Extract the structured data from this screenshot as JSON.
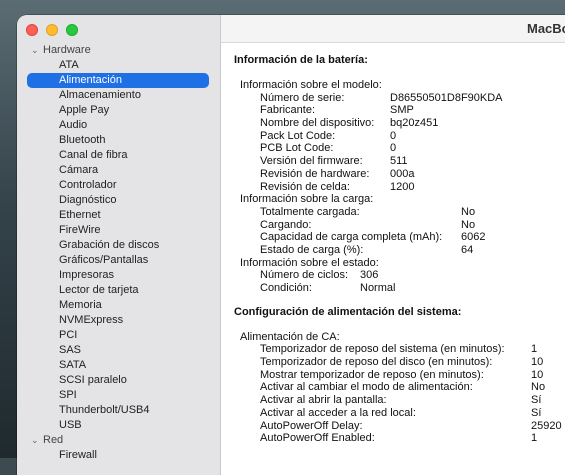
{
  "window": {
    "title": "MacBo"
  },
  "sidebar": {
    "groups": [
      {
        "label": "Hardware",
        "items": [
          "ATA",
          "Alimentación",
          "Almacenamiento",
          "Apple Pay",
          "Audio",
          "Bluetooth",
          "Canal de fibra",
          "Cámara",
          "Controlador",
          "Diagnóstico",
          "Ethernet",
          "FireWire",
          "Grabación de discos",
          "Gráficos/Pantallas",
          "Impresoras",
          "Lector de tarjeta",
          "Memoria",
          "NVMExpress",
          "PCI",
          "SAS",
          "SATA",
          "SCSI paralelo",
          "SPI",
          "Thunderbolt/USB4",
          "USB"
        ]
      },
      {
        "label": "Red",
        "items": [
          "Firewall"
        ]
      }
    ],
    "selected": "Alimentación"
  },
  "battery": {
    "heading": "Información de la batería:",
    "model": {
      "label": "Información sobre el modelo:",
      "rows": [
        {
          "k": "Número de serie:",
          "v": "D86550501D8F90KDA"
        },
        {
          "k": "Fabricante:",
          "v": "SMP"
        },
        {
          "k": "Nombre del dispositivo:",
          "v": "bq20z451"
        },
        {
          "k": "Pack Lot Code:",
          "v": "0"
        },
        {
          "k": "PCB Lot Code:",
          "v": "0"
        },
        {
          "k": "Versión del firmware:",
          "v": "511"
        },
        {
          "k": "Revisión de hardware:",
          "v": "000a"
        },
        {
          "k": "Revisión de celda:",
          "v": "1200"
        }
      ]
    },
    "charge": {
      "label": "Información sobre la carga:",
      "rows": [
        {
          "k": "Totalmente cargada:",
          "v": "No"
        },
        {
          "k": "Cargando:",
          "v": "No"
        },
        {
          "k": "Capacidad de carga completa (mAh):",
          "v": "6062"
        },
        {
          "k": "Estado de carga (%):",
          "v": "64"
        }
      ]
    },
    "status": {
      "label": "Información sobre el estado:",
      "rows": [
        {
          "k": "Número de ciclos:",
          "v": "306"
        },
        {
          "k": "Condición:",
          "v": "Normal"
        }
      ]
    }
  },
  "power": {
    "heading": "Configuración de alimentación del sistema:",
    "ac": {
      "label": "Alimentación de CA:",
      "rows": [
        {
          "k": "Temporizador de reposo del sistema (en minutos):",
          "v": "1"
        },
        {
          "k": "Temporizador de reposo del disco (en minutos):",
          "v": "10"
        },
        {
          "k": "Mostrar temporizador de reposo (en minutos):",
          "v": "10"
        },
        {
          "k": "Activar al cambiar el modo de alimentación:",
          "v": "No"
        },
        {
          "k": "Activar al abrir la pantalla:",
          "v": "Sí"
        },
        {
          "k": "Activar al acceder a la red local:",
          "v": "Sí"
        },
        {
          "k": "AutoPowerOff Delay:",
          "v": "25920"
        },
        {
          "k": "AutoPowerOff Enabled:",
          "v": "1"
        }
      ]
    }
  },
  "colors": {
    "selection": "#1f6fe5",
    "sidebar": "#e4e3e6"
  }
}
